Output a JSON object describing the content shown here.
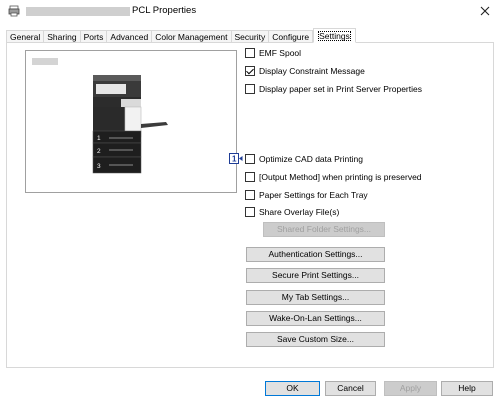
{
  "window": {
    "title": "PCL Properties"
  },
  "tabs": [
    {
      "label": "General",
      "active": false
    },
    {
      "label": "Sharing",
      "active": false
    },
    {
      "label": "Ports",
      "active": false
    },
    {
      "label": "Advanced",
      "active": false
    },
    {
      "label": "Color Management",
      "active": false
    },
    {
      "label": "Security",
      "active": false
    },
    {
      "label": "Configure",
      "active": false
    },
    {
      "label": "Settings",
      "active": true
    }
  ],
  "options": {
    "emf_spool": {
      "label": "EMF Spool",
      "checked": false
    },
    "display_constraint": {
      "label": "Display Constraint Message",
      "checked": true
    },
    "display_paper_set": {
      "label": "Display paper set in Print Server Properties",
      "checked": false
    },
    "optimize_cad": {
      "label": "Optimize CAD data Printing",
      "checked": false
    },
    "output_method": {
      "label": "[Output Method] when printing is preserved",
      "checked": false
    },
    "paper_settings_tray": {
      "label": "Paper Settings for Each Tray",
      "checked": false
    },
    "share_overlay": {
      "label": "Share Overlay File(s)",
      "checked": false
    }
  },
  "buttons": {
    "shared_folder": "Shared Folder Settings...",
    "authentication": "Authentication Settings...",
    "secure_print": "Secure Print Settings...",
    "my_tab": "My Tab Settings...",
    "wake_on_lan": "Wake-On-Lan Settings...",
    "custom_size": "Save Custom Size...",
    "ok": "OK",
    "cancel": "Cancel",
    "apply": "Apply",
    "help": "Help"
  },
  "printer_tray_numbers": [
    "1",
    "2",
    "3"
  ],
  "info_badge": "1",
  "colors": {
    "accent": "#0078d7",
    "button_face": "#e1e1e1",
    "border": "#adadad"
  }
}
